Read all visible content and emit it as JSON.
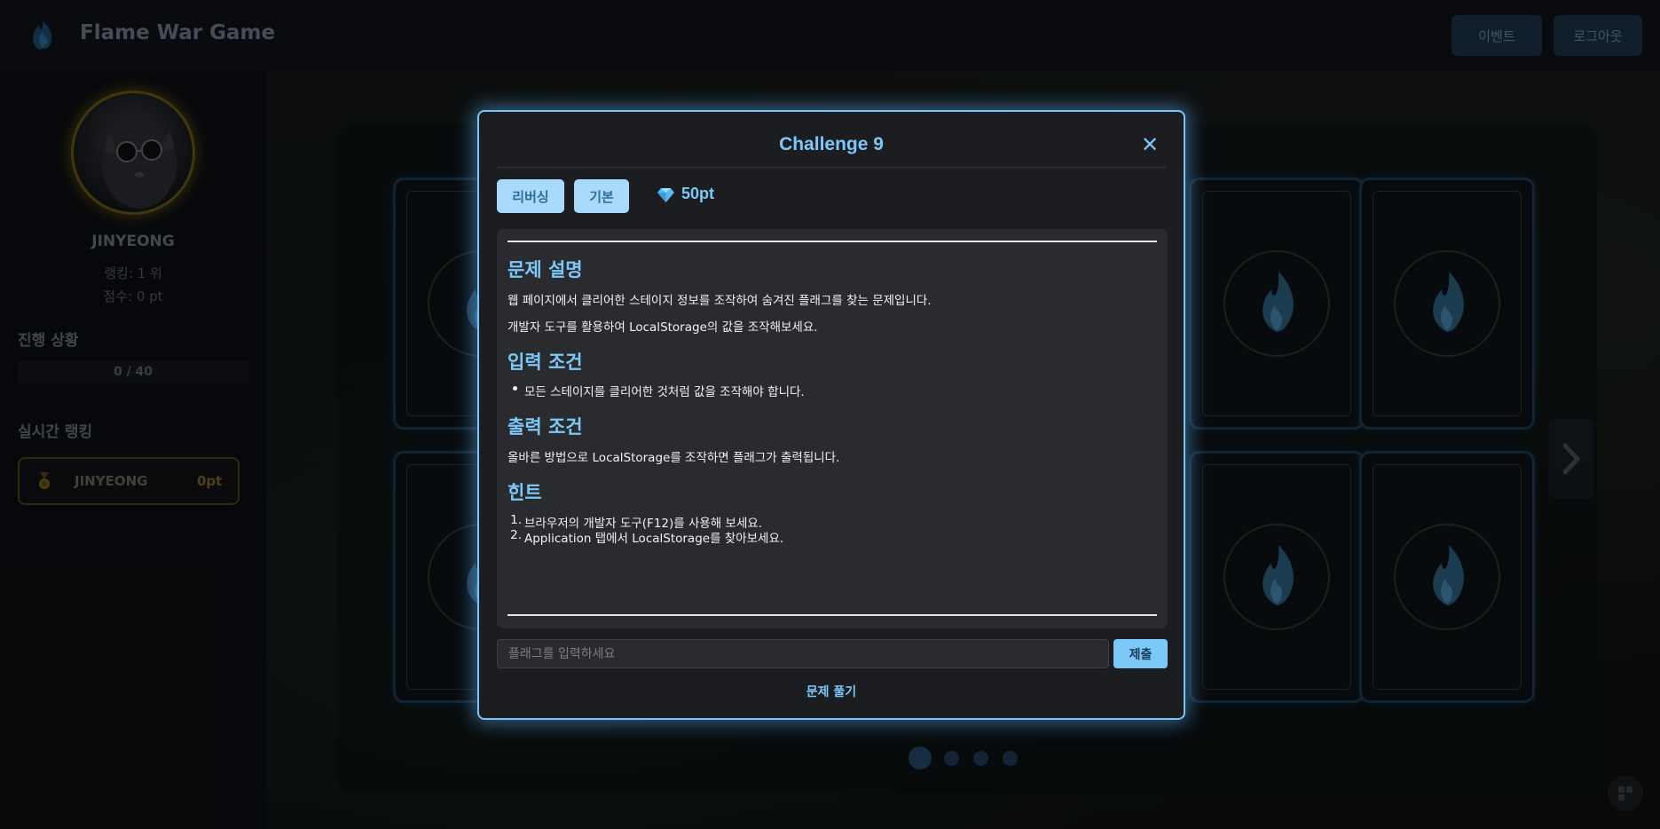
{
  "header": {
    "logo_text": "FLAME",
    "brand": "Flame War Game",
    "event_label": "이벤트",
    "logout_label": "로그아웃"
  },
  "sidebar": {
    "username": "JINYEONG",
    "rank_text": "랭킹: 1 위",
    "score_text": "점수: 0 pt",
    "progress_title": "진행 상황",
    "progress_text": "0 / 40",
    "progress_value": 0,
    "ranking_title": "실시간 랭킹",
    "ranking": [
      {
        "name": "JINYEONG",
        "points": "0pt"
      }
    ]
  },
  "board": {
    "pages": 4,
    "active_page": 1
  },
  "modal": {
    "title": "Challenge 9",
    "close_icon": "close-icon",
    "tags": [
      "리버싱",
      "기본"
    ],
    "points": "50pt",
    "sections": {
      "description_heading": "문제 설명",
      "description_p1": "웹 페이지에서 클리어한 스테이지 정보를 조작하여 숨겨진 플래그를 찾는 문제입니다.",
      "description_p2": "개발자 도구를 활용하여 LocalStorage의 값을 조작해보세요.",
      "input_heading": "입력 조건",
      "input_item": "모든 스테이지를 클리어한 것처럼 값을 조작해야 합니다.",
      "output_heading": "출력 조건",
      "output_p": "올바른 방법으로 LocalStorage를 조작하면 플래그가 출력됩니다.",
      "hint_heading": "힌트",
      "hints": [
        "브라우저의 개발자 도구(F12)를 사용해 보세요.",
        "Application 탭에서 LocalStorage를 찾아보세요."
      ]
    },
    "flag_placeholder": "플래그를 입력하세요",
    "submit_label": "제출",
    "solve_label": "문제 풀기"
  },
  "colors": {
    "accent": "#7cc8f8",
    "modal_bg": "#1c1d20",
    "gold": "#6b5a12"
  }
}
